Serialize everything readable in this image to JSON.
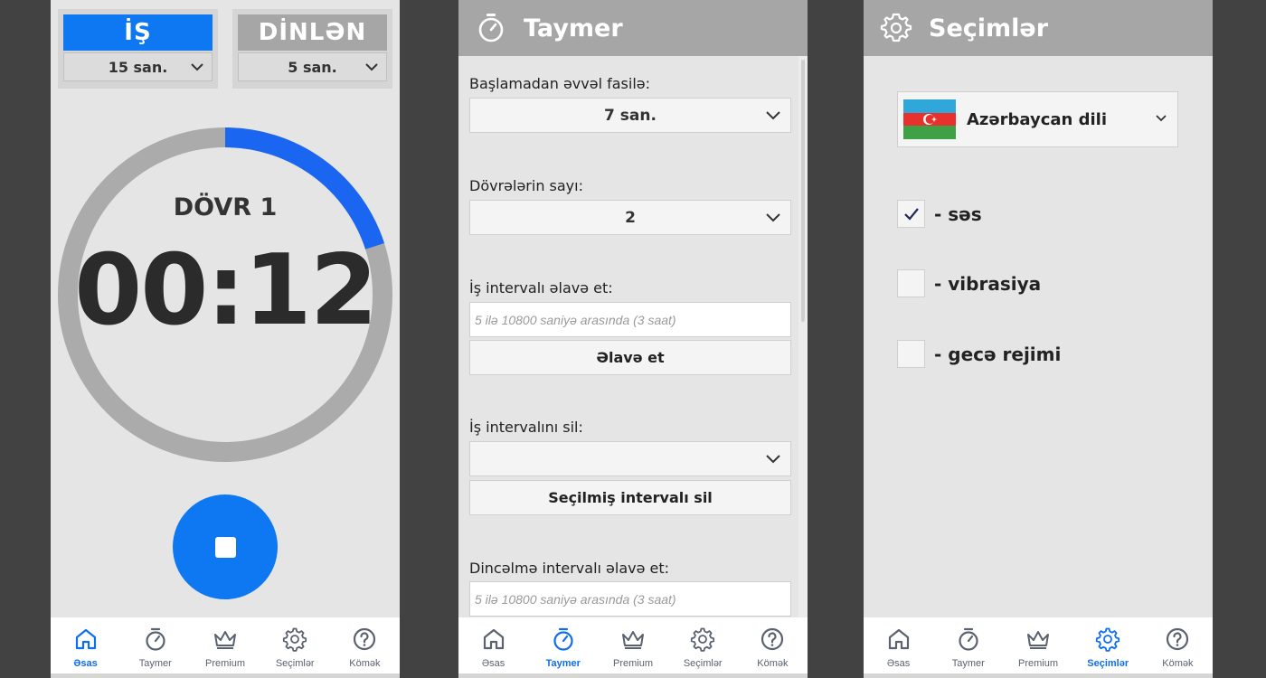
{
  "colors": {
    "accent": "#0d78f2",
    "header": "#a6a6a6",
    "background": "#e5e5e5",
    "ring_track": "#ababab",
    "nav_active": "#0d6ef0"
  },
  "nav": [
    {
      "label": "Əsas",
      "icon": "home-icon"
    },
    {
      "label": "Taymer",
      "icon": "stopwatch-icon"
    },
    {
      "label": "Premium",
      "icon": "crown-icon"
    },
    {
      "label": "Seçimlər",
      "icon": "gear-icon"
    },
    {
      "label": "Kömək",
      "icon": "help-icon"
    }
  ],
  "main": {
    "work": {
      "title": "İŞ",
      "value": "15 san."
    },
    "rest": {
      "title": "DİNLƏN",
      "value": "5 san."
    },
    "cycle_label": "DÖVR 1",
    "time": "00:12",
    "progress_fraction": 0.2,
    "stop_button_icon": "stop-icon",
    "active_nav": "Əsas"
  },
  "timer_screen": {
    "header_title": "Taymer",
    "header_icon": "stopwatch-icon",
    "pre_pause_label": "Başlamadan əvvəl fasilə:",
    "pre_pause_value": "7 san.",
    "rounds_label": "Dövrələrin sayı:",
    "rounds_value": "2",
    "add_work_label": "İş intervalı əlavə et:",
    "add_work_placeholder": "5 ilə 10800 saniyə arasında (3 saat)",
    "add_button": "Əlavə et",
    "delete_work_label": "İş intervalını sil:",
    "delete_work_value": "",
    "delete_button": "Seçilmiş intervalı sil",
    "add_rest_label": "Dincəlmə intervalı əlavə et:",
    "add_rest_placeholder": "5 ilə 10800 saniyə arasında (3 saat)",
    "active_nav": "Taymer"
  },
  "settings_screen": {
    "header_title": "Seçimlər",
    "header_icon": "gear-icon",
    "language": "Azərbaycan dili",
    "language_flag": "azerbaijan-flag-icon",
    "options": [
      {
        "label": "- səs",
        "checked": true
      },
      {
        "label": "- vibrasiya",
        "checked": false
      },
      {
        "label": "- gecə rejimi",
        "checked": false
      }
    ],
    "active_nav": "Seçimlər"
  }
}
